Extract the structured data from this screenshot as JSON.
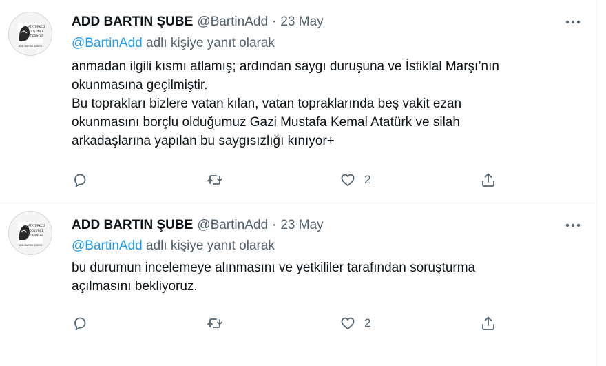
{
  "tweets": [
    {
      "author_name": "ADD BARTIN ŞUBE",
      "handle": "@BartinAdd",
      "separator": "·",
      "date": "23 May",
      "replying_mention": "@BartinAdd",
      "replying_suffix": " adlı kişiye yanıt olarak",
      "body_lines": [
        "anmadan ilgili kısmı atlamış; ardından saygı duruşuna ve İstiklal Marşı’nın",
        "okunmasına geçilmiştir.",
        "Bu toprakları bizlere vatan kılan, vatan topraklarında beş vakit ezan",
        "okunmasını borçlu olduğumuz Gazi Mustafa Kemal Atatürk ve silah",
        "arkadaşlarına yapılan bu saygısızlığı kınıyor+"
      ],
      "like_count": "2",
      "avatar_lines": [
        "ATATÜRKÇÜ",
        "DÜŞÜNCE",
        "DERNEĞİ",
        "ADD BARTIN ŞUBESİ"
      ]
    },
    {
      "author_name": "ADD BARTIN ŞUBE",
      "handle": "@BartinAdd",
      "separator": "·",
      "date": "23 May",
      "replying_mention": "@BartinAdd",
      "replying_suffix": " adlı kişiye yanıt olarak",
      "body_lines": [
        "bu durumun incelemeye alınmasını ve yetkililer tarafından soruşturma",
        "açılmasını bekliyoruz."
      ],
      "like_count": "2",
      "avatar_lines": [
        "ATATÜRKÇÜ",
        "DÜŞÜNCE",
        "DERNEĞİ",
        "ADD BARTIN ŞUBESİ"
      ]
    }
  ],
  "colors": {
    "text": "#0f1419",
    "secondary": "#536471",
    "link": "#1d9bf0",
    "divider": "#eff3f4"
  },
  "icons": [
    "more-icon",
    "reply-icon",
    "retweet-icon",
    "like-icon",
    "share-icon"
  ]
}
